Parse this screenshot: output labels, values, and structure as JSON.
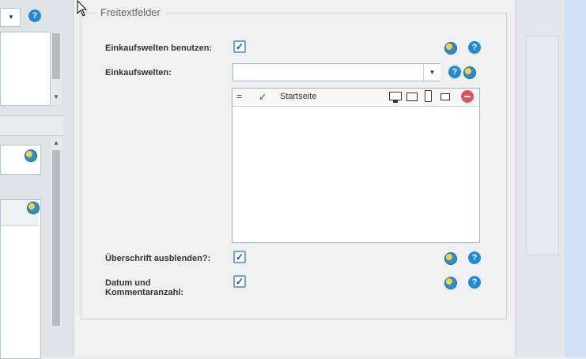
{
  "fieldset": {
    "legend": "Freitextfelder"
  },
  "fields": {
    "use_shopping_worlds": {
      "label": "Einkaufswelten benutzen:",
      "checked": true
    },
    "shopping_worlds": {
      "label": "Einkaufswelten:",
      "value": "",
      "grid": {
        "columns": [
          "=",
          "✓",
          "Startseite"
        ]
      }
    },
    "hide_headline": {
      "label": "Überschrift ausblenden?:",
      "checked": true
    },
    "date_comments": {
      "label_line1": "Datum und",
      "label_line2": "Kommentaranzahl:",
      "checked": true
    }
  },
  "icons": {
    "globe": "globe-icon",
    "help": "help-icon",
    "help_glyph": "?",
    "check_glyph": "✓",
    "dropdown_glyph": "▼"
  },
  "colors": {
    "accent": "#1f8ad6",
    "checkbox_border": "#6ea6d8",
    "remove": "#e05656"
  }
}
